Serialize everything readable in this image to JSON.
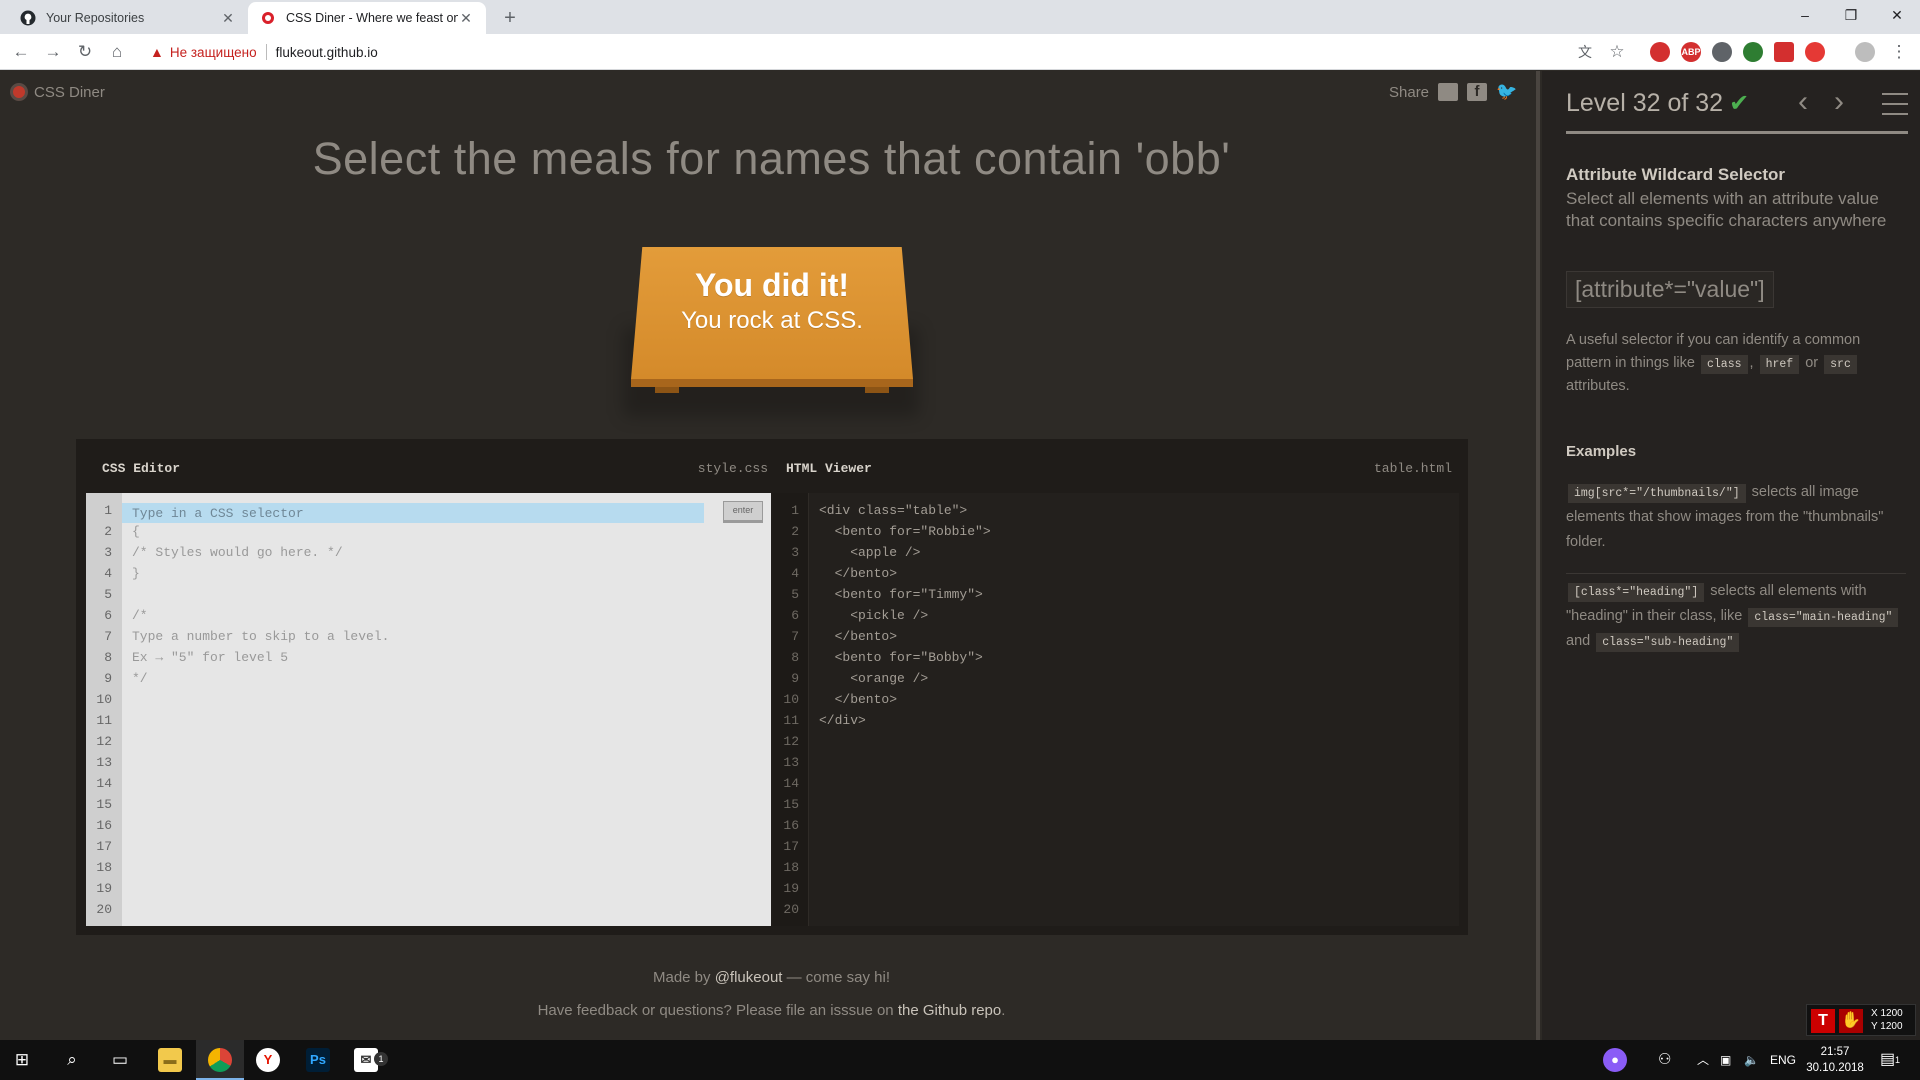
{
  "browser": {
    "tabs": [
      {
        "title": "Your Repositories",
        "active": false
      },
      {
        "title": "CSS Diner - Where we feast on C",
        "active": true
      }
    ],
    "new_tab": "+",
    "window_controls": {
      "minimize": "–",
      "maximize": "❐",
      "close": "✕"
    },
    "security_label": "Не защищено",
    "url": "flukeout.github.io"
  },
  "page": {
    "logo": "CSS Diner",
    "share_label": "Share",
    "order_instruction": "Select the meals for names that contain 'obb'",
    "table_message_line1": "You did it!",
    "table_message_line2": "You rock at CSS.",
    "css_editor": {
      "title": "CSS Editor",
      "filename": "style.css",
      "input_placeholder": "Type in a CSS selector",
      "enter_label": "enter",
      "lines": [
        "{",
        "/* Styles would go here. */",
        "}",
        "",
        "/*",
        "Type a number to skip to a level.",
        "Ex → \"5\" for level 5",
        "*/"
      ],
      "line_numbers": [
        "1",
        "2",
        "3",
        "4",
        "5",
        "6",
        "7",
        "8",
        "9",
        "10",
        "11",
        "12",
        "13",
        "14",
        "15",
        "16",
        "17",
        "18",
        "19",
        "20"
      ]
    },
    "html_viewer": {
      "title": "HTML Viewer",
      "filename": "table.html",
      "lines": [
        "<div class=\"table\">",
        "  <bento for=\"Robbie\">",
        "    <apple />",
        "  </bento>",
        "  <bento for=\"Timmy\">",
        "    <pickle />",
        "  </bento>",
        "  <bento for=\"Bobby\">",
        "    <orange />",
        "  </bento>",
        "</div>"
      ],
      "line_numbers": [
        "1",
        "2",
        "3",
        "4",
        "5",
        "6",
        "7",
        "8",
        "9",
        "10",
        "11",
        "12",
        "13",
        "14",
        "15",
        "16",
        "17",
        "18",
        "19",
        "20"
      ]
    },
    "footer": {
      "made_by_prefix": "Made by ",
      "made_by_link": "@flukeout",
      "made_by_suffix": " — come say hi!",
      "feedback_prefix": "Have feedback or questions? Please file an isssue on ",
      "feedback_link": "the Github repo",
      "feedback_suffix": "."
    }
  },
  "sidebar": {
    "level_title": "Level 32 of 32",
    "progress": 1.0,
    "selector_name": "Attribute Wildcard Selector",
    "selector_title": "Select all elements with an attribute value that contains specific characters anywhere",
    "syntax": "[attribute*=\"value\"]",
    "hint_prefix": "A useful selector if you can identify a common pattern in things like ",
    "hint_tag1": "class",
    "hint_comma": ", ",
    "hint_tag2": "href",
    "hint_or": " or ",
    "hint_tag3": "src",
    "hint_suffix": " attributes.",
    "examples_heading": "Examples",
    "example1_code": "img[src*=\"/thumbnails/\"]",
    "example1_text": " selects all image elements that show images from the \"thumbnails\" folder.",
    "example2_code": "[class*=\"heading\"]",
    "example2_text": " selects all elements with \"heading\" in their class, like ",
    "example2_code2": "class=\"main-heading\"",
    "example2_and": " and ",
    "example2_code3": "class=\"sub-heading\""
  },
  "overlay": {
    "x_readout": "X 1200",
    "y_readout": "Y 1200"
  },
  "taskbar": {
    "language": "ENG",
    "time": "21:57",
    "date": "30.10.2018",
    "notification_badge": "1",
    "mail_badge": "1"
  },
  "colors": {
    "page_bg": "#2d2a26",
    "sidebar_bg": "#252220",
    "table_orange": "#e39c3a",
    "check_green": "#4caf50",
    "input_highlight": "#b7dbef",
    "insecure_red": "#c5221f"
  }
}
